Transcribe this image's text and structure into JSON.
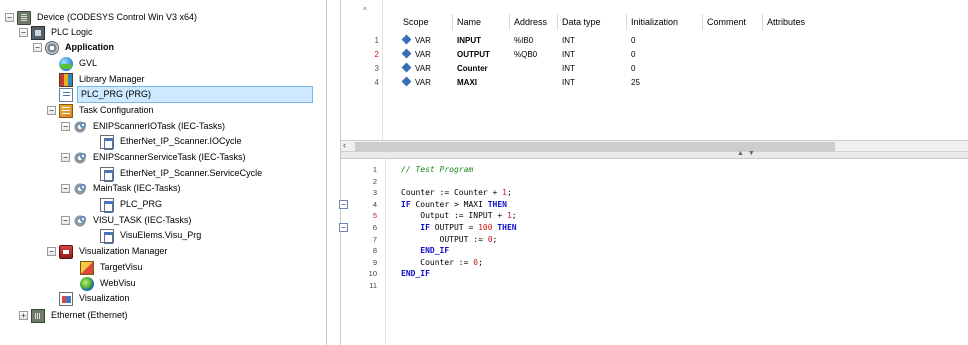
{
  "tree": {
    "device": "Device (CODESYS Control Win V3 x64)",
    "plc_logic": "PLC Logic",
    "application": "Application",
    "gvl": "GVL",
    "library_manager": "Library Manager",
    "plc_prg": "PLC_PRG (PRG)",
    "task_configuration": "Task Configuration",
    "enip_io_task": "ENIPScannerIOTask (IEC-Tasks)",
    "enip_io_call": "EtherNet_IP_Scanner.IOCycle",
    "enip_service_task": "ENIPScannerServiceTask (IEC-Tasks)",
    "enip_service_call": "EtherNet_IP_Scanner.ServiceCycle",
    "main_task": "MainTask (IEC-Tasks)",
    "main_call": "PLC_PRG",
    "visu_task": "VISU_TASK (IEC-Tasks)",
    "visu_call": "VisuElems.Visu_Prg",
    "visualization_manager": "Visualization Manager",
    "target_visu": "TargetVisu",
    "web_visu": "WebVisu",
    "visualization": "Visualization",
    "ethernet": "Ethernet (Ethernet)"
  },
  "decl": {
    "headers": [
      "Scope",
      "Name",
      "Address",
      "Data type",
      "Initialization",
      "Comment",
      "Attributes"
    ],
    "rows": [
      {
        "num": "1",
        "scope": "VAR",
        "name": "INPUT",
        "address": "%IB0",
        "type": "INT",
        "init": "0"
      },
      {
        "num": "2",
        "scope": "VAR",
        "name": "OUTPUT",
        "address": "%QB0",
        "type": "INT",
        "init": "0"
      },
      {
        "num": "3",
        "scope": "VAR",
        "name": "Counter",
        "address": "",
        "type": "INT",
        "init": "0"
      },
      {
        "num": "4",
        "scope": "VAR",
        "name": "MAXI",
        "address": "",
        "type": "INT",
        "init": "25"
      }
    ]
  },
  "code": {
    "lines": [
      {
        "num": "1",
        "text": "// Test Program"
      },
      {
        "num": "2",
        "text": ""
      },
      {
        "num": "3",
        "text": "Counter := Counter + 1;"
      },
      {
        "num": "4",
        "text": "IF Counter > MAXI THEN"
      },
      {
        "num": "5",
        "text": "    Output := INPUT + 1;"
      },
      {
        "num": "6",
        "text": "    IF OUTPUT = 100 THEN"
      },
      {
        "num": "7",
        "text": "        OUTPUT := 0;"
      },
      {
        "num": "8",
        "text": "    END_IF"
      },
      {
        "num": "9",
        "text": "    Counter := 0;"
      },
      {
        "num": "10",
        "text": "END_IF"
      },
      {
        "num": "11",
        "text": ""
      }
    ]
  },
  "colors": {
    "keyword": "#1010c8",
    "comment": "#1a8a1a",
    "number": "#c81818",
    "selection": "#cde8ff"
  }
}
